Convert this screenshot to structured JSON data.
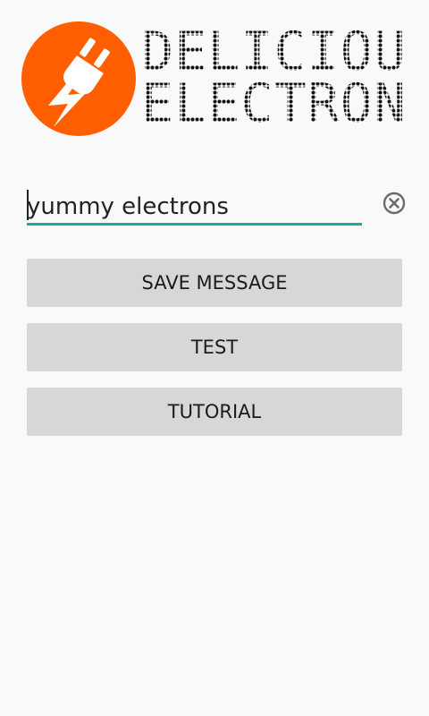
{
  "header": {
    "brand_line1": "DELICIOUS",
    "brand_line2": "ELECTRONS",
    "logo_color": "#ff5f00"
  },
  "message_input": {
    "value": "yummy electrons",
    "underline_color": "#26a69a",
    "clear_icon": "clear-circle-x-icon"
  },
  "buttons": {
    "save_label": "SAVE MESSAGE",
    "test_label": "TEST",
    "tutorial_label": "TUTORIAL",
    "background": "#d6d7d7"
  }
}
